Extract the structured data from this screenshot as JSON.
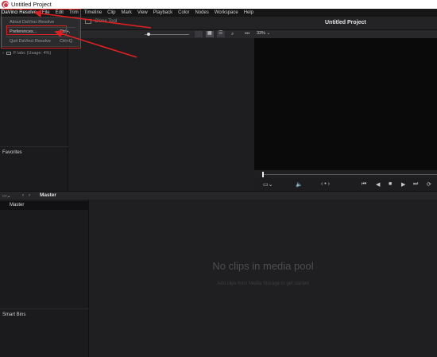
{
  "window": {
    "title": "Untitled Project"
  },
  "menubar": {
    "items": [
      "DaVinci Resolve",
      "File",
      "Edit",
      "Trim",
      "Timeline",
      "Clip",
      "Mark",
      "View",
      "Playback",
      "Color",
      "Nodes",
      "Workspace",
      "Help"
    ]
  },
  "dropdown": {
    "about": "About DaVinci Resolve",
    "preferences": "Preferences...",
    "preferences_shortcut": "Ctrl+,",
    "quit": "Quit DaVinci Resolve",
    "quit_shortcut": "Ctrl+Q"
  },
  "topstrip": {
    "clone_tool": "Clone Tool",
    "project_title": "Untitled Project"
  },
  "viewer": {
    "zoom": "33%"
  },
  "media_storage": {
    "item": "F:\\abc (Usage: 4%)",
    "favorites": "Favorites"
  },
  "media_pool": {
    "title": "Master",
    "bin_master": "Master",
    "smart_bins": "Smart Bins",
    "empty_title": "No clips in media pool",
    "empty_hint": "Add clips from Media Storage to get started"
  },
  "colors": {
    "annotation_red": "#e02020",
    "brand": "#d8384b"
  },
  "icons": [
    "logo-icon",
    "clone-icon",
    "search-icon",
    "grid-icon",
    "list-icon",
    "speaker-icon",
    "play-icon",
    "stop-icon",
    "loop-icon",
    "panel-icon"
  ]
}
